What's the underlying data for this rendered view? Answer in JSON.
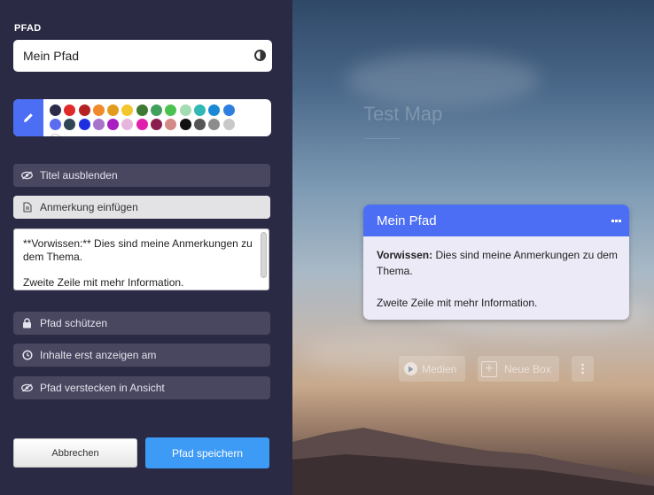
{
  "sidebar": {
    "section_label": "PFAD",
    "name_value": "Mein Pfad",
    "palette_colors": [
      "#2c2c4a",
      "#e02a2a",
      "#b52222",
      "#f08a2a",
      "#e29b1e",
      "#f2c62c",
      "#3f7a34",
      "#41a05c",
      "#4bc24f",
      "#a3dcb0",
      "#2fb8b5",
      "#1a8ad6",
      "#2f7fe0",
      "#5a6cf0",
      "#2f4656",
      "#1d2fe0",
      "#a774ca",
      "#a81ec0",
      "#e7b6dc",
      "#e21fad",
      "#8a1e4e",
      "#d38a86",
      "#111111",
      "#555555",
      "#8c8c8c",
      "#c8c8c8",
      "#ffffff"
    ],
    "options": {
      "hide_title": "Titel ausblenden",
      "add_note": "Anmerkung einfügen",
      "protect": "Pfad schützen",
      "show_later": "Inhalte erst anzeigen am",
      "hide_in_view": "Pfad verstecken in Ansicht"
    },
    "note_text": "**Vorwissen:** Dies sind meine Anmerkungen zu dem Thema.\n\nZweite Zeile mit mehr Information.",
    "cancel_label": "Abbrechen",
    "save_label": "Pfad speichern"
  },
  "map": {
    "title": "Test Map"
  },
  "card": {
    "title": "Mein Pfad",
    "bold_label": "Vorwissen:",
    "line1": " Dies sind meine Anmerkungen zu dem Thema.",
    "line2": "Zweite Zeile mit mehr Information."
  },
  "toolbar": {
    "media_label": "Medien",
    "new_box_label": "Neue Box"
  },
  "colors": {
    "sidebar_bg": "#2b2a45",
    "accent_blue": "#4c6ef5",
    "save_button": "#3d9af5"
  }
}
